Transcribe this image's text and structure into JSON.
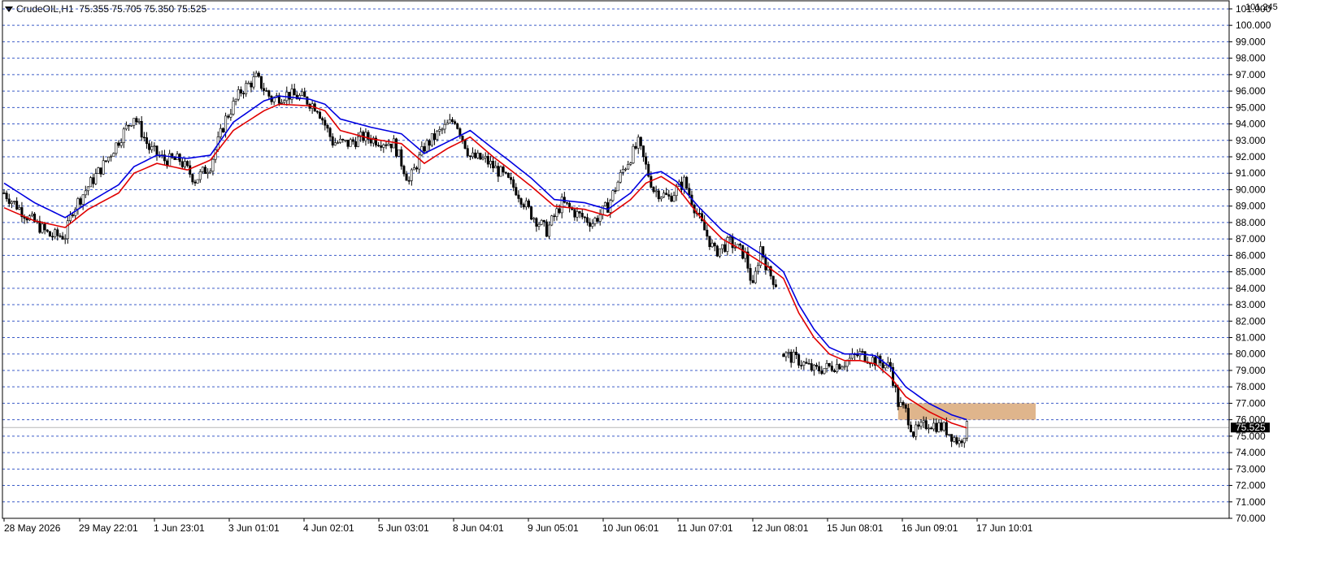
{
  "header": {
    "symbol": "CrudeOIL,H1",
    "ohlc": "75.355 75.705 75.350 75.525"
  },
  "colors": {
    "background": "#ffffff",
    "grid": "#3c5cc8",
    "candle": "#000000",
    "ma_fast": "#e00000",
    "ma_slow": "#0000e0",
    "zone": "#d9a878",
    "price_line": "#b8b8b8",
    "price_tag_bg": "#000000"
  },
  "chart_data": {
    "type": "candlestick",
    "title": "CrudeOIL,H1",
    "ylim": [
      70.0,
      101.245
    ],
    "y_ticks": [
      "101.000",
      "100.000",
      "99.000",
      "98.000",
      "97.000",
      "96.000",
      "95.000",
      "94.000",
      "93.000",
      "92.000",
      "91.000",
      "90.000",
      "89.000",
      "88.000",
      "87.000",
      "86.000",
      "85.000",
      "84.000",
      "83.000",
      "82.000",
      "81.000",
      "80.000",
      "79.000",
      "78.000",
      "77.000",
      "76.000",
      "75.000",
      "74.000",
      "73.000",
      "72.000",
      "71.000",
      "70.000"
    ],
    "y_top_label": "101.245",
    "current_price": "75.525",
    "x_labels": [
      "28 May 2026",
      "29 May 22:01",
      "1 Jun 23:01",
      "3 Jun 01:01",
      "4 Jun 02:01",
      "5 Jun 03:01",
      "8 Jun 04:01",
      "9 Jun 05:01",
      "10 Jun 06:01",
      "11 Jun 07:01",
      "12 Jun 08:01",
      "15 Jun 08:01",
      "16 Jun 09:01",
      "17 Jun 10:01"
    ],
    "price_path": [
      [
        0,
        89.8
      ],
      [
        3,
        88.4
      ],
      [
        6,
        87.2
      ],
      [
        8,
        87.2
      ],
      [
        9,
        88.8
      ],
      [
        11,
        90.2
      ],
      [
        13,
        91.5
      ],
      [
        17,
        94.5
      ],
      [
        19,
        92.5
      ],
      [
        21,
        91.8
      ],
      [
        23,
        91.8
      ],
      [
        25,
        90.6
      ],
      [
        27,
        91.5
      ],
      [
        29,
        94.3
      ],
      [
        31,
        96.0
      ],
      [
        33,
        96.8
      ],
      [
        35,
        95.5
      ],
      [
        37,
        95.8
      ],
      [
        39,
        95.6
      ],
      [
        41,
        95.0
      ],
      [
        43,
        92.9
      ],
      [
        45,
        92.8
      ],
      [
        47,
        93.2
      ],
      [
        49,
        93.0
      ],
      [
        51,
        92.8
      ],
      [
        53,
        90.5
      ],
      [
        55,
        92.6
      ],
      [
        57,
        93.5
      ],
      [
        59,
        94.3
      ],
      [
        61,
        92.0
      ],
      [
        63,
        91.8
      ],
      [
        65,
        91.0
      ],
      [
        67,
        90.0
      ],
      [
        69,
        88.5
      ],
      [
        71,
        87.5
      ],
      [
        73,
        89.2
      ],
      [
        75,
        88.5
      ],
      [
        77,
        88.0
      ],
      [
        79,
        89.0
      ],
      [
        81,
        91.2
      ],
      [
        83,
        92.8
      ],
      [
        85,
        90.0
      ],
      [
        87,
        89.5
      ],
      [
        89,
        90.5
      ],
      [
        91,
        88.2
      ],
      [
        93,
        86.2
      ],
      [
        95,
        86.8
      ],
      [
        97,
        86.0
      ],
      [
        98,
        84.0
      ],
      [
        99,
        86.5
      ],
      [
        100,
        85.0
      ],
      [
        101,
        84.3
      ],
      [
        102,
        80.0
      ],
      [
        104,
        79.6
      ],
      [
        106,
        79.0
      ],
      [
        108,
        79.2
      ],
      [
        110,
        79.5
      ],
      [
        112,
        80.0
      ],
      [
        114,
        79.6
      ],
      [
        116,
        79.2
      ],
      [
        117,
        77.0
      ],
      [
        118,
        76.5
      ],
      [
        119,
        75.2
      ],
      [
        121,
        75.8
      ],
      [
        123,
        75.5
      ],
      [
        125,
        74.6
      ],
      [
        126,
        75.525
      ]
    ],
    "gap": {
      "from": 101,
      "to": 102,
      "note": ""
    },
    "ma_fast_path": [
      [
        0,
        88.9
      ],
      [
        4,
        88.1
      ],
      [
        8,
        87.7
      ],
      [
        11,
        88.8
      ],
      [
        15,
        89.8
      ],
      [
        17,
        91.0
      ],
      [
        20,
        91.6
      ],
      [
        24,
        91.2
      ],
      [
        27,
        91.8
      ],
      [
        30,
        93.6
      ],
      [
        34,
        94.8
      ],
      [
        36,
        95.2
      ],
      [
        40,
        95.1
      ],
      [
        42,
        94.8
      ],
      [
        44,
        93.6
      ],
      [
        48,
        93.1
      ],
      [
        52,
        92.8
      ],
      [
        55,
        91.6
      ],
      [
        58,
        92.5
      ],
      [
        61,
        93.2
      ],
      [
        64,
        92.0
      ],
      [
        66,
        91.3
      ],
      [
        69,
        90.2
      ],
      [
        72,
        89.0
      ],
      [
        76,
        88.8
      ],
      [
        79,
        88.4
      ],
      [
        82,
        89.4
      ],
      [
        84,
        90.4
      ],
      [
        86,
        90.8
      ],
      [
        88,
        90.2
      ],
      [
        91,
        88.4
      ],
      [
        94,
        87.0
      ],
      [
        97,
        86.2
      ],
      [
        100,
        85.3
      ],
      [
        102,
        84.6
      ],
      [
        104,
        82.5
      ],
      [
        106,
        81.0
      ],
      [
        108,
        80.0
      ],
      [
        110,
        79.6
      ],
      [
        112,
        79.6
      ],
      [
        114,
        79.4
      ],
      [
        116,
        78.6
      ],
      [
        118,
        77.4
      ],
      [
        121,
        76.5
      ],
      [
        124,
        75.8
      ],
      [
        126,
        75.5
      ]
    ],
    "ma_slow_path": [
      [
        0,
        90.4
      ],
      [
        4,
        89.2
      ],
      [
        8,
        88.3
      ],
      [
        11,
        89.2
      ],
      [
        15,
        90.3
      ],
      [
        17,
        91.4
      ],
      [
        20,
        92.1
      ],
      [
        24,
        91.9
      ],
      [
        27,
        92.1
      ],
      [
        30,
        94.1
      ],
      [
        34,
        95.4
      ],
      [
        36,
        95.7
      ],
      [
        40,
        95.5
      ],
      [
        42,
        95.2
      ],
      [
        44,
        94.3
      ],
      [
        48,
        93.8
      ],
      [
        52,
        93.4
      ],
      [
        55,
        92.2
      ],
      [
        58,
        92.9
      ],
      [
        61,
        93.6
      ],
      [
        64,
        92.5
      ],
      [
        66,
        91.8
      ],
      [
        69,
        90.7
      ],
      [
        72,
        89.4
      ],
      [
        76,
        89.2
      ],
      [
        79,
        88.8
      ],
      [
        82,
        89.8
      ],
      [
        84,
        90.9
      ],
      [
        86,
        91.1
      ],
      [
        88,
        90.5
      ],
      [
        91,
        88.9
      ],
      [
        94,
        87.5
      ],
      [
        97,
        86.7
      ],
      [
        100,
        85.8
      ],
      [
        102,
        85.0
      ],
      [
        104,
        83.0
      ],
      [
        106,
        81.5
      ],
      [
        108,
        80.4
      ],
      [
        110,
        80.0
      ],
      [
        112,
        80.0
      ],
      [
        114,
        79.9
      ],
      [
        116,
        79.2
      ],
      [
        118,
        78.0
      ],
      [
        121,
        77.0
      ],
      [
        124,
        76.3
      ],
      [
        126,
        76.0
      ]
    ],
    "zone": {
      "y_low": 76.0,
      "y_high": 77.0,
      "bar_from": 117,
      "bar_to": 135
    }
  }
}
